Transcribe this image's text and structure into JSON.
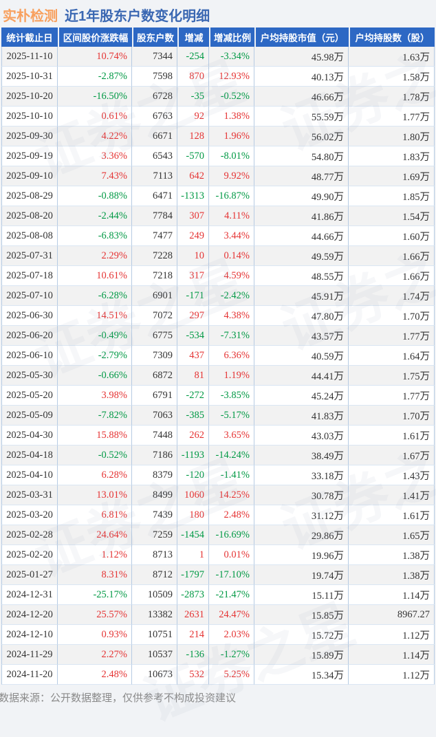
{
  "page": {
    "stock_name": "实朴检测",
    "title": "近1年股东户数变化明细",
    "footnote": "数据来源：公开数据整理，仅供参考不构成投资建议",
    "watermark": "证券之星"
  },
  "colors": {
    "accent_orange": "#f8a05e",
    "accent_blue": "#3a67b2",
    "header_bg": "#2d68c4",
    "up": "#e53333",
    "down": "#009944",
    "border_v": "#b6cbe3",
    "border_h": "#dae6f3",
    "row_alt": "#f2f2f2",
    "page_bg": "#f1f3f6",
    "footer_text": "#8a8a8a"
  },
  "chart_data": {
    "type": "table",
    "title": "实朴检测 近1年股东户数变化明细",
    "columns": [
      "统计截止日",
      "区间股价涨跌幅",
      "股东户数",
      "增减",
      "增减比例",
      "户均持股市值（元）",
      "户均持股数（股）"
    ],
    "signed_columns": [
      1,
      3,
      4
    ],
    "rows": [
      [
        "2025-11-10",
        "10.74%",
        "7344",
        "-254",
        "-3.34%",
        "45.98万",
        "1.63万"
      ],
      [
        "2025-10-31",
        "-2.87%",
        "7598",
        "870",
        "12.93%",
        "40.13万",
        "1.58万"
      ],
      [
        "2025-10-20",
        "-16.50%",
        "6728",
        "-35",
        "-0.52%",
        "46.66万",
        "1.78万"
      ],
      [
        "2025-10-10",
        "0.61%",
        "6763",
        "92",
        "1.38%",
        "55.59万",
        "1.77万"
      ],
      [
        "2025-09-30",
        "4.22%",
        "6671",
        "128",
        "1.96%",
        "56.02万",
        "1.80万"
      ],
      [
        "2025-09-19",
        "3.36%",
        "6543",
        "-570",
        "-8.01%",
        "54.80万",
        "1.83万"
      ],
      [
        "2025-09-10",
        "7.43%",
        "7113",
        "642",
        "9.92%",
        "48.77万",
        "1.69万"
      ],
      [
        "2025-08-29",
        "-0.88%",
        "6471",
        "-1313",
        "-16.87%",
        "49.90万",
        "1.85万"
      ],
      [
        "2025-08-20",
        "-2.44%",
        "7784",
        "307",
        "4.11%",
        "41.86万",
        "1.54万"
      ],
      [
        "2025-08-08",
        "-6.83%",
        "7477",
        "249",
        "3.44%",
        "44.66万",
        "1.60万"
      ],
      [
        "2025-07-31",
        "2.29%",
        "7228",
        "10",
        "0.14%",
        "49.59万",
        "1.66万"
      ],
      [
        "2025-07-18",
        "10.61%",
        "7218",
        "317",
        "4.59%",
        "48.55万",
        "1.66万"
      ],
      [
        "2025-07-10",
        "-6.28%",
        "6901",
        "-171",
        "-2.42%",
        "45.91万",
        "1.74万"
      ],
      [
        "2025-06-30",
        "14.51%",
        "7072",
        "297",
        "4.38%",
        "47.80万",
        "1.70万"
      ],
      [
        "2025-06-20",
        "-0.49%",
        "6775",
        "-534",
        "-7.31%",
        "43.57万",
        "1.77万"
      ],
      [
        "2025-06-10",
        "-2.79%",
        "7309",
        "437",
        "6.36%",
        "40.59万",
        "1.64万"
      ],
      [
        "2025-05-30",
        "-0.66%",
        "6872",
        "81",
        "1.19%",
        "44.41万",
        "1.75万"
      ],
      [
        "2025-05-20",
        "3.98%",
        "6791",
        "-272",
        "-3.85%",
        "45.24万",
        "1.77万"
      ],
      [
        "2025-05-09",
        "-7.82%",
        "7063",
        "-385",
        "-5.17%",
        "41.83万",
        "1.70万"
      ],
      [
        "2025-04-30",
        "15.88%",
        "7448",
        "262",
        "3.65%",
        "43.03万",
        "1.61万"
      ],
      [
        "2025-04-18",
        "-0.52%",
        "7186",
        "-1193",
        "-14.24%",
        "38.49万",
        "1.67万"
      ],
      [
        "2025-04-10",
        "6.28%",
        "8379",
        "-120",
        "-1.41%",
        "33.18万",
        "1.43万"
      ],
      [
        "2025-03-31",
        "13.01%",
        "8499",
        "1060",
        "14.25%",
        "30.78万",
        "1.41万"
      ],
      [
        "2025-03-20",
        "6.81%",
        "7439",
        "180",
        "2.48%",
        "31.12万",
        "1.61万"
      ],
      [
        "2025-02-28",
        "24.64%",
        "7259",
        "-1454",
        "-16.69%",
        "29.86万",
        "1.65万"
      ],
      [
        "2025-02-20",
        "1.12%",
        "8713",
        "1",
        "0.01%",
        "19.96万",
        "1.38万"
      ],
      [
        "2025-01-27",
        "8.31%",
        "8712",
        "-1797",
        "-17.10%",
        "19.74万",
        "1.38万"
      ],
      [
        "2024-12-31",
        "-25.17%",
        "10509",
        "-2873",
        "-21.47%",
        "15.11万",
        "1.14万"
      ],
      [
        "2024-12-20",
        "25.57%",
        "13382",
        "2631",
        "24.47%",
        "15.85万",
        "8967.27"
      ],
      [
        "2024-12-10",
        "0.93%",
        "10751",
        "214",
        "2.03%",
        "15.72万",
        "1.12万"
      ],
      [
        "2024-11-29",
        "2.27%",
        "10537",
        "-136",
        "-1.27%",
        "15.89万",
        "1.14万"
      ],
      [
        "2024-11-20",
        "2.48%",
        "10673",
        "532",
        "5.25%",
        "15.34万",
        "1.12万"
      ]
    ]
  }
}
